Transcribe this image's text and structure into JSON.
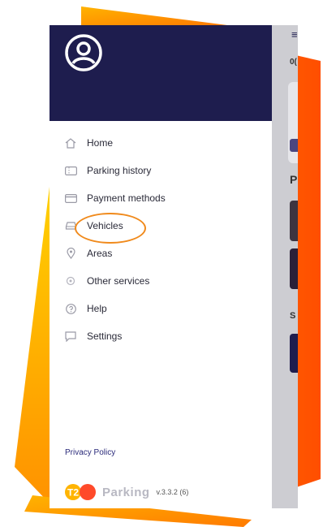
{
  "drawer": {
    "avatar_icon": "user-circle-icon",
    "menu": [
      {
        "label": "Home",
        "icon": "home-icon"
      },
      {
        "label": "Parking history",
        "icon": "ticket-icon"
      },
      {
        "label": "Payment methods",
        "icon": "credit-card-icon"
      },
      {
        "label": "Vehicles",
        "icon": "car-icon",
        "highlighted": true
      },
      {
        "label": "Areas",
        "icon": "location-pin-icon"
      },
      {
        "label": "Other services",
        "icon": "services-icon"
      },
      {
        "label": "Help",
        "icon": "help-icon"
      },
      {
        "label": "Settings",
        "icon": "chat-icon"
      }
    ],
    "privacy_label": "Privacy Policy",
    "brand": {
      "badge": "T2",
      "name": "Parking",
      "version": "v.3.3.2 (6)"
    }
  },
  "background": {
    "hamburger": "≡",
    "text_fragment": "0(",
    "section_letters": [
      "P",
      "S"
    ]
  },
  "colors": {
    "header": "#1e1d4e",
    "accent_orange": "#f08a1c",
    "link": "#2a2a7a"
  }
}
